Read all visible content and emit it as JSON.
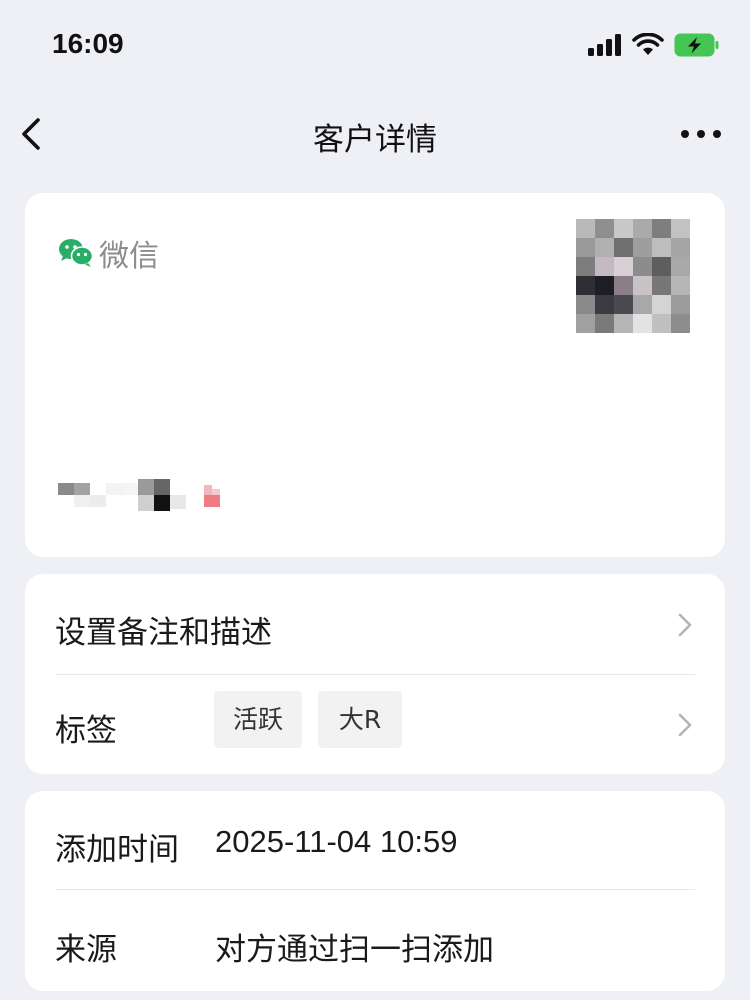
{
  "status_bar": {
    "time": "16:09",
    "icons": [
      "signal-icon",
      "wifi-icon",
      "battery-charging-icon"
    ]
  },
  "nav": {
    "title": "客户详情",
    "back_icon": "chevron-left-icon",
    "more_icon": "more-dots-icon"
  },
  "profile": {
    "source_label": "微信",
    "source_icon": "wechat-icon",
    "accent_color": "#2aae67"
  },
  "menu": {
    "remark_label": "设置备注和描述",
    "tags_label": "标签",
    "tags": [
      "活跃",
      "大R"
    ]
  },
  "info": {
    "added_time_label": "添加时间",
    "added_time_value": "2025-11-04 10:59",
    "source_label": "来源",
    "source_value": "对方通过扫一扫添加"
  }
}
